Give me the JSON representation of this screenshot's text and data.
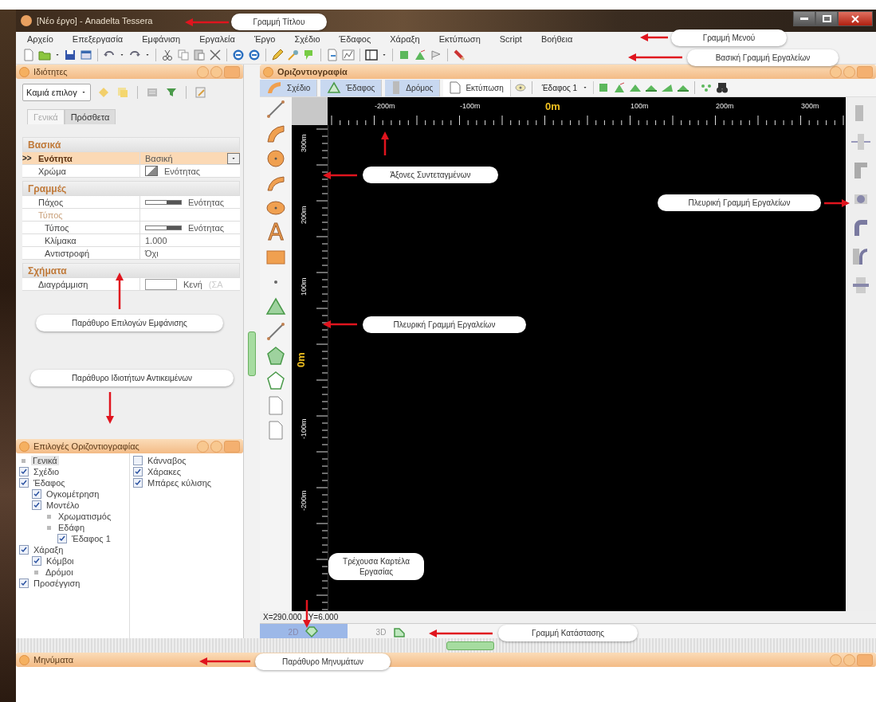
{
  "window": {
    "title": "[Νέο έργο] - Anadelta Tessera"
  },
  "menu": [
    "Αρχείο",
    "Επεξεργασία",
    "Εμφάνιση",
    "Εργαλεία",
    "Έργο",
    "Σχέδιο",
    "Έδαφος",
    "Χάραξη",
    "Εκτύπωση",
    "Script",
    "Βοήθεια"
  ],
  "properties_panel": {
    "title": "Ιδιότητες",
    "selector": "Καμιά επιλογ",
    "tabs": [
      {
        "label": "Γενικά",
        "selected": true
      },
      {
        "label": "Πρόσθετα",
        "selected": false
      }
    ],
    "selection_marker": ">>",
    "groups": [
      {
        "title": "Βασικά",
        "rows": [
          {
            "kind": "dropdown",
            "label": "Ενότητα",
            "value": "Βασική",
            "selected": true
          },
          {
            "kind": "swatch",
            "label": "Χρώμα",
            "value": "Ενότητας",
            "selected": false
          }
        ]
      },
      {
        "title": "Γραμμές",
        "rows": [
          {
            "kind": "line",
            "label": "Πάχος",
            "value": "Ενότητας",
            "selected": false
          },
          {
            "kind": "subheader",
            "label": "Τύπος",
            "selected": false,
            "children": [
              {
                "kind": "line",
                "label": "Τύπος",
                "value": "Ενότητας",
                "selected": false
              },
              {
                "kind": "text",
                "label": "Κλίμακα",
                "value": "1.000",
                "selected": false
              },
              {
                "kind": "text",
                "label": "Αντιστροφή",
                "value": "Όχι",
                "selected": false
              }
            ]
          }
        ]
      },
      {
        "title": "Σχήματα",
        "rows": [
          {
            "kind": "fill",
            "label": "Διαγράμμιση",
            "value": "Κενή",
            "note": "(ΣΑ",
            "selected": false
          }
        ]
      }
    ]
  },
  "options_panel": {
    "title": "Επιλογές Οριζοντιογραφίας",
    "columns": [
      [
        {
          "kind": "bullet",
          "label": "Γενικά",
          "selected": true
        },
        {
          "kind": "check",
          "label": "Σχέδιο",
          "checked": true,
          "selected": false
        },
        {
          "kind": "check",
          "label": "Έδαφος",
          "checked": true,
          "selected": false,
          "children": [
            {
              "kind": "check",
              "label": "Ογκομέτρηση",
              "checked": true,
              "selected": false
            },
            {
              "kind": "check",
              "label": "Μοντέλο",
              "checked": true,
              "selected": false,
              "children": [
                {
                  "kind": "bullet",
                  "label": "Χρωματισμός",
                  "selected": false
                },
                {
                  "kind": "bullet",
                  "label": "Εδάφη",
                  "selected": false,
                  "children": [
                    {
                      "kind": "check",
                      "label": "Έδαφος 1",
                      "checked": true,
                      "selected": false
                    }
                  ]
                }
              ]
            }
          ]
        },
        {
          "kind": "check",
          "label": "Χάραξη",
          "checked": true,
          "selected": false,
          "children": [
            {
              "kind": "check",
              "label": "Κόμβοι",
              "checked": true,
              "selected": false
            },
            {
              "kind": "bullet",
              "label": "Δρόμοι",
              "selected": false
            }
          ]
        },
        {
          "kind": "check",
          "label": "Προσέγγιση",
          "checked": true,
          "selected": false
        }
      ],
      [
        {
          "kind": "check",
          "label": "Κάνναβος",
          "checked": false,
          "selected": false
        },
        {
          "kind": "check",
          "label": "Χάρακες",
          "checked": true,
          "selected": false
        },
        {
          "kind": "check",
          "label": "Μπάρες κύλισης",
          "checked": true,
          "selected": false
        }
      ]
    ]
  },
  "plan_panel": {
    "title": "Οριζοντιογραφία",
    "modes": [
      {
        "label": "Σχέδιο",
        "on": true
      },
      {
        "label": "Έδαφος",
        "on": true
      },
      {
        "label": "Δρόμος",
        "on": true
      },
      {
        "label": "Εκτύπωση",
        "on": false
      }
    ],
    "terrain": "Έδαφος 1",
    "text_tool": "A",
    "ruler_x": [
      {
        "label": "-200m",
        "origin": false
      },
      {
        "label": "-100m",
        "origin": false
      },
      {
        "label": "0m",
        "origin": true
      },
      {
        "label": "100m",
        "origin": false
      },
      {
        "label": "200m",
        "origin": false
      },
      {
        "label": "300m",
        "origin": false
      }
    ],
    "ruler_y": [
      {
        "label": "300m",
        "origin": false
      },
      {
        "label": "200m",
        "origin": false
      },
      {
        "label": "100m",
        "origin": false
      },
      {
        "label": "0m",
        "origin": true
      },
      {
        "label": "-100m",
        "origin": false
      },
      {
        "label": "-200m",
        "origin": false
      }
    ],
    "status": [
      "X=290.000",
      "Y=6.000"
    ],
    "view_tabs": [
      {
        "label": "2D",
        "selected": true
      },
      {
        "label": "3D",
        "selected": false
      }
    ]
  },
  "messages_panel": {
    "title": "Μηνύματα"
  },
  "annotations": [
    "Γραμμή Τίτλου",
    "Γραμμή Μενού",
    "Βασική Γραμμή Εργαλείων",
    "Άξονες Συντεταγμένων",
    "Πλευρική Γραμμή Εργαλείων",
    "Παράθυρο Επιλογών Εμφάνισης",
    "Πλευρική Γραμμή Εργαλείων",
    "Παράθυρο Ιδιοτήτων Αντικειμένων",
    "Τρέχουσα Καρτέλα Εργασίας",
    "Γραμμή Κατάστασης",
    "Παράθυρο Μηνυμάτων"
  ]
}
